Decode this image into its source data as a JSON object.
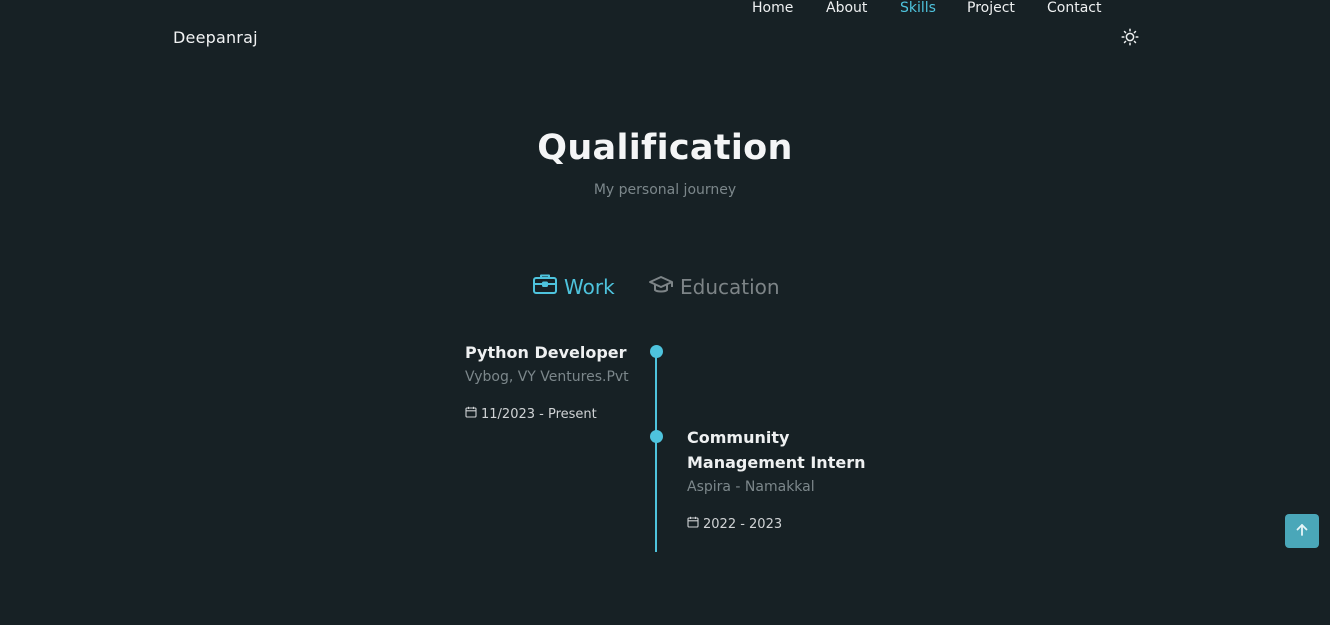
{
  "nav": {
    "logo": "Deepanraj",
    "items": [
      {
        "label": "Home",
        "active": false
      },
      {
        "label": "About",
        "active": false
      },
      {
        "label": "Skills",
        "active": true
      },
      {
        "label": "Project",
        "active": false
      },
      {
        "label": "Contact",
        "active": false
      }
    ],
    "theme_icon": "sun-icon"
  },
  "section": {
    "title": "Qualification",
    "subtitle": "My personal journey"
  },
  "tabs": [
    {
      "label": "Work",
      "icon": "briefcase-icon",
      "active": true
    },
    {
      "label": "Education",
      "icon": "graduation-cap-icon",
      "active": false
    }
  ],
  "work": [
    {
      "title": "Python Developer",
      "company": "Vybog, VY Ventures.Pvt",
      "date": "11/2023 - Present"
    },
    {
      "title_line1": "Community",
      "title_line2": "Management Intern",
      "company": "Aspira - Namakkal",
      "date": "2022 - 2023"
    }
  ],
  "colors": {
    "background": "#172125",
    "accent": "#4ec3dd",
    "muted": "#7c878b",
    "scroll_button": "#4aa7b9"
  },
  "scroll_up_icon": "arrow-up-icon"
}
